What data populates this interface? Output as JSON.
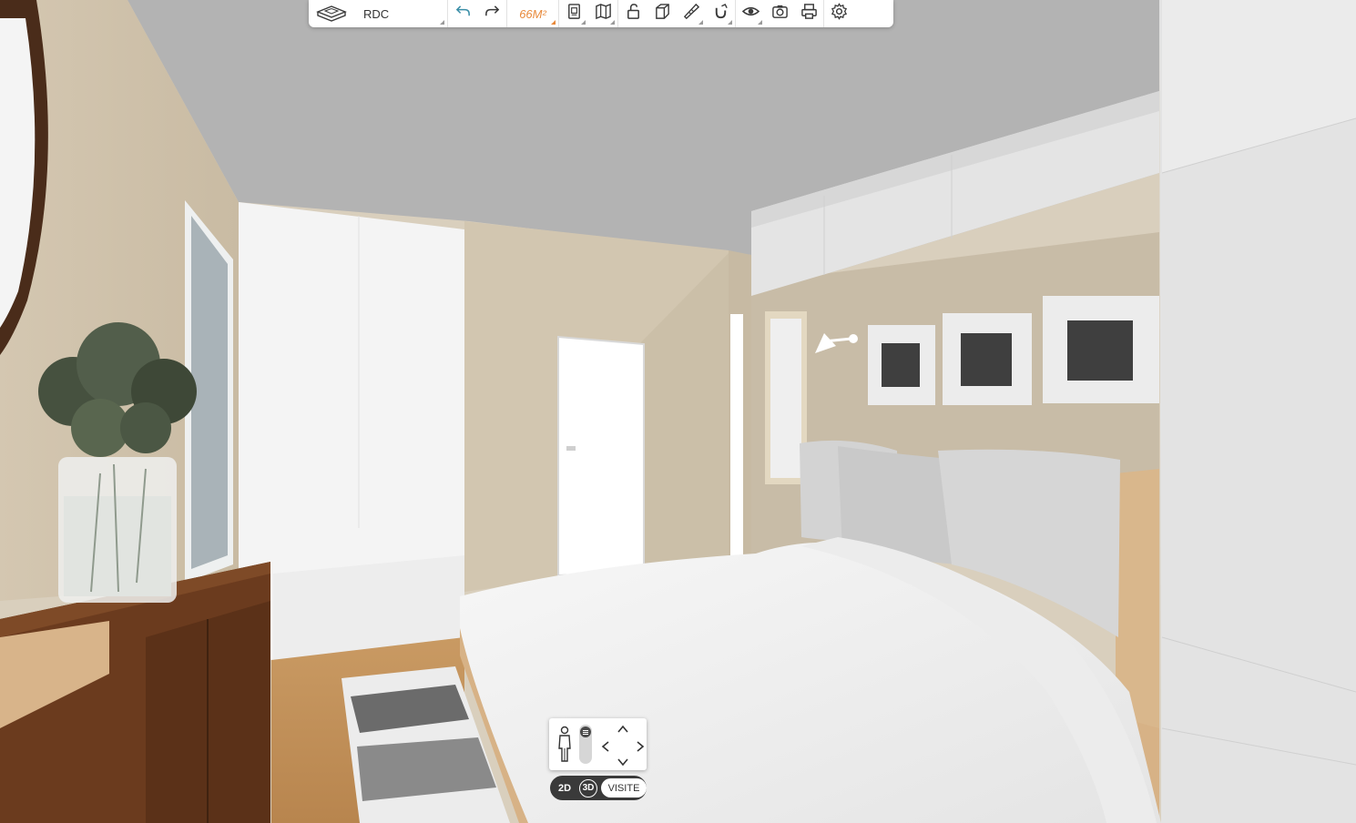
{
  "toolbar": {
    "level_label": "RDC",
    "area_label": "66M²",
    "icons": {
      "level": "floor-plan-level-icon",
      "undo": "undo-icon",
      "redo": "redo-icon",
      "document": "document-icon",
      "map": "map-icon",
      "lock": "unlock-icon",
      "cube": "cube-3d-icon",
      "ruler": "ruler-icon",
      "magnet": "magnet-icon",
      "eye": "eye-icon",
      "camera": "camera-icon",
      "print": "print-icon",
      "settings": "gear-icon"
    }
  },
  "view_controls": {
    "mode_2d": "2D",
    "mode_3d": "3D",
    "mode_visit": "VISITE"
  },
  "colors": {
    "accent": "#e8893a",
    "toolbar_bg": "#ffffff",
    "icon": "#3a3a3a",
    "undo_icon": "#3b8fa8"
  }
}
